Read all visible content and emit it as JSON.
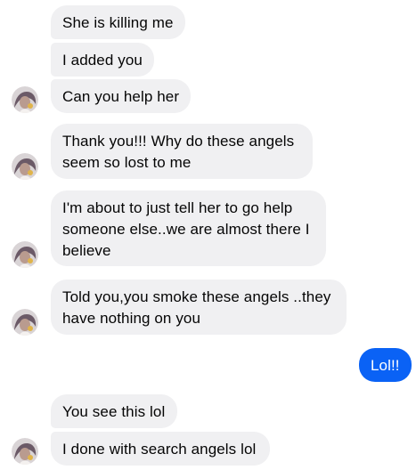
{
  "conversation": {
    "messages": [
      {
        "sender": "them",
        "lines": [
          "She is killing me"
        ]
      },
      {
        "sender": "them",
        "lines": [
          "I added you"
        ]
      },
      {
        "sender": "them",
        "lines": [
          "Can you help her"
        ]
      },
      {
        "sender": "them",
        "lines": [
          "Thank you!!! Why do these angels",
          "seem so lost to me"
        ]
      },
      {
        "sender": "them",
        "lines": [
          "I'm about to just tell her to go help",
          "someone else..we are almost there I",
          "believe"
        ]
      },
      {
        "sender": "them",
        "lines": [
          "Told you,you smoke these angels ..they",
          "have nothing on you"
        ]
      },
      {
        "sender": "me",
        "lines": [
          "Lol!!"
        ]
      },
      {
        "sender": "them",
        "lines": [
          "You see this lol"
        ]
      },
      {
        "sender": "them",
        "lines": [
          "I done with search angels lol"
        ]
      }
    ]
  },
  "theme": {
    "incoming_bubble_color": "#f0f0f2",
    "outgoing_bubble_color": "#0a62f5",
    "avatar_icon": "contact-avatar-icon"
  }
}
